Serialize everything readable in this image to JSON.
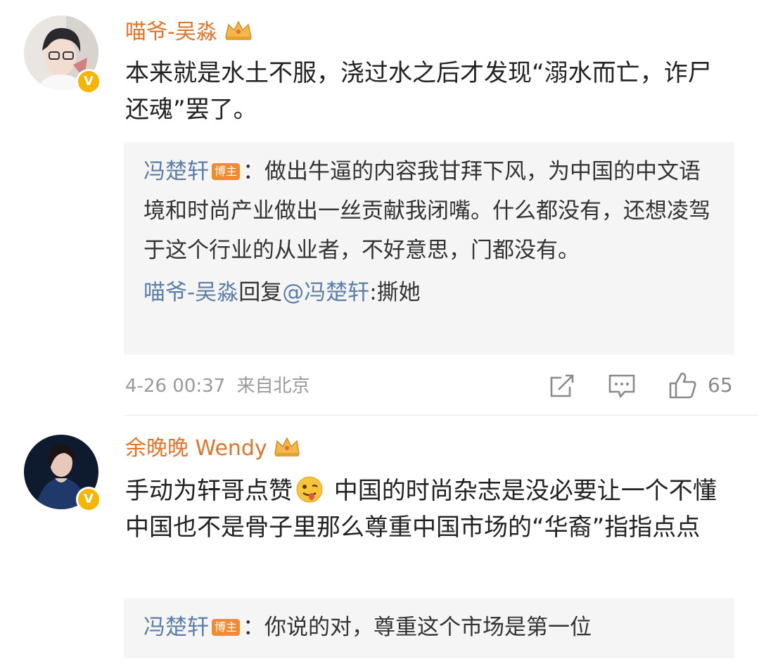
{
  "comments": [
    {
      "username": "喵爷-吴淼",
      "badge_icon": "crown-icon",
      "verified_icon": "v-badge",
      "text": "本来就是水土不服，浇过水之后才发现“溺水而亡，诈尸还魂”罢了。",
      "reply": {
        "author": "冯楚轩",
        "author_tag": "博主",
        "text": "：做出牛逼的内容我甘拜下风，为中国的中文语境和时尚产业做出一丝贡献我闭嘴。什么都没有，还想凌驾于这个行业的从业者，不好意思，门都没有。",
        "sub_reply_author": "喵爷-吴淼",
        "sub_reply_verb": "回复",
        "sub_reply_mention": "@冯楚轩",
        "sub_reply_text": ":撕她"
      },
      "timestamp": "4-26 00:37",
      "location": "来自北京",
      "like_count": "65"
    },
    {
      "username": "余晚晚 Wendy",
      "badge_icon": "crown-icon",
      "verified_icon": "v-badge",
      "text_before_emoji": "手动为轩哥点赞",
      "emoji": "wink-tongue-emoji",
      "text_after_emoji": " 中国的时尚杂志是没必要让一个不懂中国也不是骨子里那么尊重中国市场的“华裔”指指点点",
      "reply": {
        "author": "冯楚轩",
        "author_tag": "博主",
        "text": "：你说的对，尊重这个市场是第一位"
      }
    }
  ],
  "colors": {
    "username": "#e0752a",
    "reply_name": "#5b7fa8",
    "reply_bg": "#f5f5f5",
    "meta": "#9a9a9a",
    "tag_bg": "#f08b2e",
    "verified": "#f7b500"
  }
}
